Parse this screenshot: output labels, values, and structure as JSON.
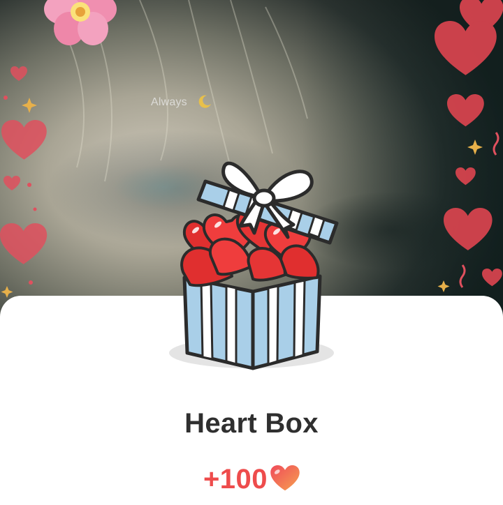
{
  "story": {
    "caption": "Always",
    "caption_icon": "crescent-moon-icon"
  },
  "reward_card": {
    "gift_icon": "heart-box-gift-icon",
    "title": "Heart Box",
    "amount": "+100",
    "currency_icon": "heart-icon"
  },
  "colors": {
    "accent_red": "#ee4c4c",
    "gift_blue": "#a9cfe8",
    "heart_red": "#e53935",
    "title_text": "#2f2f2f"
  }
}
